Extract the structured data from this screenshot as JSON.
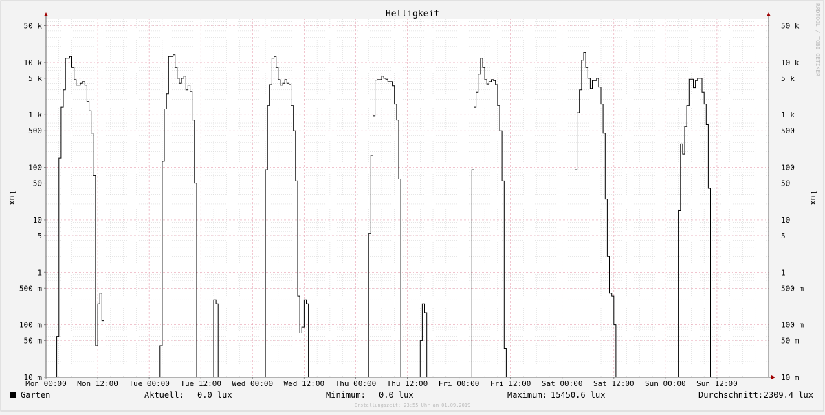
{
  "watermark": "RRDTOOL / TOBI OETIKER",
  "footer": "Erstellungszeit: 23:55 Uhr am 01.09.2019",
  "legend": {
    "series_name": "Garten",
    "current_label": "Aktuell:",
    "current_value": "0.0 lux",
    "min_label": "Minimum:",
    "min_value": "0.0 lux",
    "max_label": "Maximum:",
    "max_value": "15450.6 lux",
    "avg_label": "Durchschnitt:",
    "avg_value": "2309.4 lux"
  },
  "colors": {
    "background": "#f3f3f3",
    "plot": "#ffffff",
    "line": "#000000",
    "major_grid": "#e8a0b0",
    "minor_grid": "#cccccc"
  },
  "chart_data": {
    "type": "line",
    "title": "Helligkeit",
    "ylabel": "lux",
    "y_scale": "log",
    "ylim": [
      0.01,
      90000
    ],
    "xlim": [
      0,
      168
    ],
    "x_unit": "hours from Mon 00:00",
    "grid": true,
    "legend_position": "bottom",
    "y_ticks": [
      {
        "v": 0.01,
        "label": "10 m"
      },
      {
        "v": 0.05,
        "label": "50 m"
      },
      {
        "v": 0.1,
        "label": "100 m"
      },
      {
        "v": 0.5,
        "label": "500 m"
      },
      {
        "v": 1,
        "label": "1"
      },
      {
        "v": 5,
        "label": "5"
      },
      {
        "v": 10,
        "label": "10"
      },
      {
        "v": 50,
        "label": "50"
      },
      {
        "v": 100,
        "label": "100"
      },
      {
        "v": 500,
        "label": "500"
      },
      {
        "v": 1000,
        "label": "1 k"
      },
      {
        "v": 5000,
        "label": "5 k"
      },
      {
        "v": 10000,
        "label": "10 k"
      },
      {
        "v": 50000,
        "label": "50 k"
      }
    ],
    "x_ticks": [
      {
        "t": 0,
        "label": "Mon 00:00"
      },
      {
        "t": 12,
        "label": "Mon 12:00"
      },
      {
        "t": 24,
        "label": "Tue 00:00"
      },
      {
        "t": 36,
        "label": "Tue 12:00"
      },
      {
        "t": 48,
        "label": "Wed 00:00"
      },
      {
        "t": 60,
        "label": "Wed 12:00"
      },
      {
        "t": 72,
        "label": "Thu 00:00"
      },
      {
        "t": 84,
        "label": "Thu 12:00"
      },
      {
        "t": 96,
        "label": "Fri 00:00"
      },
      {
        "t": 108,
        "label": "Fri 12:00"
      },
      {
        "t": 120,
        "label": "Sat 00:00"
      },
      {
        "t": 132,
        "label": "Sat 12:00"
      },
      {
        "t": 144,
        "label": "Sun 00:00"
      },
      {
        "t": 156,
        "label": "Sun 12:00"
      }
    ],
    "series": [
      {
        "name": "Garten",
        "points": [
          [
            0,
            0
          ],
          [
            2.5,
            0
          ],
          [
            2.5,
            0.06
          ],
          [
            3,
            0.06
          ],
          [
            3,
            150
          ],
          [
            3.5,
            150
          ],
          [
            3.5,
            1400
          ],
          [
            4,
            1400
          ],
          [
            4,
            3000
          ],
          [
            4.5,
            3000
          ],
          [
            4.5,
            12000
          ],
          [
            5.5,
            12000
          ],
          [
            5.5,
            13000
          ],
          [
            6,
            13000
          ],
          [
            6,
            8000
          ],
          [
            6.5,
            8000
          ],
          [
            6.5,
            4700
          ],
          [
            7,
            4700
          ],
          [
            7,
            3700
          ],
          [
            8,
            3700
          ],
          [
            8,
            4000
          ],
          [
            8.5,
            4000
          ],
          [
            8.5,
            4300
          ],
          [
            9,
            4300
          ],
          [
            9,
            3700
          ],
          [
            9.5,
            3700
          ],
          [
            9.5,
            1800
          ],
          [
            10,
            1800
          ],
          [
            10,
            1200
          ],
          [
            10.5,
            1200
          ],
          [
            10.5,
            450
          ],
          [
            11,
            450
          ],
          [
            11,
            70
          ],
          [
            11.5,
            70
          ],
          [
            11.5,
            0.04
          ],
          [
            12,
            0.04
          ],
          [
            12,
            0.25
          ],
          [
            12.5,
            0.25
          ],
          [
            12.5,
            0.4
          ],
          [
            13,
            0.4
          ],
          [
            13,
            0.12
          ],
          [
            13.5,
            0.12
          ],
          [
            13.5,
            0
          ],
          [
            26.5,
            0
          ],
          [
            26.5,
            0.04
          ],
          [
            27,
            0.04
          ],
          [
            27,
            130
          ],
          [
            27.5,
            130
          ],
          [
            27.5,
            1300
          ],
          [
            28,
            1300
          ],
          [
            28,
            2500
          ],
          [
            28.5,
            2500
          ],
          [
            28.5,
            13000
          ],
          [
            29.5,
            13000
          ],
          [
            29.5,
            14000
          ],
          [
            30,
            14000
          ],
          [
            30,
            8000
          ],
          [
            30.5,
            8000
          ],
          [
            30.5,
            5000
          ],
          [
            31,
            5000
          ],
          [
            31,
            4000
          ],
          [
            31.5,
            4000
          ],
          [
            31.5,
            5000
          ],
          [
            32,
            5000
          ],
          [
            32,
            5500
          ],
          [
            32.5,
            5500
          ],
          [
            32.5,
            3000
          ],
          [
            33,
            3000
          ],
          [
            33,
            3700
          ],
          [
            33.5,
            3700
          ],
          [
            33.5,
            2800
          ],
          [
            34,
            2800
          ],
          [
            34,
            800
          ],
          [
            34.5,
            800
          ],
          [
            34.5,
            50
          ],
          [
            35,
            50
          ],
          [
            35,
            0
          ],
          [
            39,
            0
          ],
          [
            39,
            0.3
          ],
          [
            39.5,
            0.3
          ],
          [
            39.5,
            0.25
          ],
          [
            40,
            0.25
          ],
          [
            40,
            0
          ],
          [
            51,
            0
          ],
          [
            51,
            90
          ],
          [
            51.5,
            90
          ],
          [
            51.5,
            1500
          ],
          [
            52,
            1500
          ],
          [
            52,
            3800
          ],
          [
            52.5,
            3800
          ],
          [
            52.5,
            12000
          ],
          [
            53,
            12000
          ],
          [
            53,
            13000
          ],
          [
            53.5,
            13000
          ],
          [
            53.5,
            8000
          ],
          [
            54,
            8000
          ],
          [
            54,
            4700
          ],
          [
            54.5,
            4700
          ],
          [
            54.5,
            3700
          ],
          [
            55,
            3700
          ],
          [
            55,
            4000
          ],
          [
            55.5,
            4000
          ],
          [
            55.5,
            4700
          ],
          [
            56,
            4700
          ],
          [
            56,
            4000
          ],
          [
            56.5,
            4000
          ],
          [
            56.5,
            3800
          ],
          [
            57,
            3800
          ],
          [
            57,
            1500
          ],
          [
            57.5,
            1500
          ],
          [
            57.5,
            500
          ],
          [
            58,
            500
          ],
          [
            58,
            55
          ],
          [
            58.5,
            55
          ],
          [
            58.5,
            0.35
          ],
          [
            59,
            0.35
          ],
          [
            59,
            0.07
          ],
          [
            59.5,
            0.07
          ],
          [
            59.5,
            0.09
          ],
          [
            60,
            0.09
          ],
          [
            60,
            0.3
          ],
          [
            60.5,
            0.3
          ],
          [
            60.5,
            0.25
          ],
          [
            61,
            0.25
          ],
          [
            61,
            0
          ],
          [
            75,
            0
          ],
          [
            75,
            5.5
          ],
          [
            75.5,
            5.5
          ],
          [
            75.5,
            170
          ],
          [
            76,
            170
          ],
          [
            76,
            950
          ],
          [
            76.5,
            950
          ],
          [
            76.5,
            4600
          ],
          [
            77,
            4600
          ],
          [
            77,
            4700
          ],
          [
            78,
            4700
          ],
          [
            78,
            5500
          ],
          [
            78.5,
            5500
          ],
          [
            78.5,
            5000
          ],
          [
            79,
            5000
          ],
          [
            79,
            4800
          ],
          [
            79.5,
            4800
          ],
          [
            79.5,
            4300
          ],
          [
            80.5,
            4300
          ],
          [
            80.5,
            3600
          ],
          [
            81,
            3600
          ],
          [
            81,
            1600
          ],
          [
            81.5,
            1600
          ],
          [
            81.5,
            800
          ],
          [
            82,
            800
          ],
          [
            82,
            60
          ],
          [
            82.5,
            60
          ],
          [
            82.5,
            0
          ],
          [
            87,
            0
          ],
          [
            87,
            0.05
          ],
          [
            87.5,
            0.05
          ],
          [
            87.5,
            0.25
          ],
          [
            88,
            0.25
          ],
          [
            88,
            0.17
          ],
          [
            88.5,
            0.17
          ],
          [
            88.5,
            0
          ],
          [
            99,
            0
          ],
          [
            99,
            90
          ],
          [
            99.5,
            90
          ],
          [
            99.5,
            1400
          ],
          [
            100,
            1400
          ],
          [
            100,
            2700
          ],
          [
            100.5,
            2700
          ],
          [
            100.5,
            6000
          ],
          [
            101,
            6000
          ],
          [
            101,
            12000
          ],
          [
            101.5,
            12000
          ],
          [
            101.5,
            8000
          ],
          [
            102,
            8000
          ],
          [
            102,
            4700
          ],
          [
            102.5,
            4700
          ],
          [
            102.5,
            3900
          ],
          [
            103,
            3900
          ],
          [
            103,
            4300
          ],
          [
            103.5,
            4300
          ],
          [
            103.5,
            4700
          ],
          [
            104,
            4700
          ],
          [
            104,
            4500
          ],
          [
            104.5,
            4500
          ],
          [
            104.5,
            3800
          ],
          [
            105,
            3800
          ],
          [
            105,
            1500
          ],
          [
            105.5,
            1500
          ],
          [
            105.5,
            500
          ],
          [
            106,
            500
          ],
          [
            106,
            55
          ],
          [
            106.5,
            55
          ],
          [
            106.5,
            0.035
          ],
          [
            107,
            0.035
          ],
          [
            107,
            0
          ],
          [
            123,
            0
          ],
          [
            123,
            90
          ],
          [
            123.5,
            90
          ],
          [
            123.5,
            1100
          ],
          [
            124,
            1100
          ],
          [
            124,
            3000
          ],
          [
            124.5,
            3000
          ],
          [
            124.5,
            11000
          ],
          [
            125,
            11000
          ],
          [
            125,
            15450
          ],
          [
            125.5,
            15450
          ],
          [
            125.5,
            8000
          ],
          [
            126,
            8000
          ],
          [
            126,
            5000
          ],
          [
            126.5,
            5000
          ],
          [
            126.5,
            3200
          ],
          [
            127,
            3200
          ],
          [
            127,
            4500
          ],
          [
            128,
            4500
          ],
          [
            128,
            5000
          ],
          [
            128.5,
            5000
          ],
          [
            128.5,
            3400
          ],
          [
            129,
            3400
          ],
          [
            129,
            1600
          ],
          [
            129.5,
            1600
          ],
          [
            129.5,
            450
          ],
          [
            130,
            450
          ],
          [
            130,
            25
          ],
          [
            130.5,
            25
          ],
          [
            130.5,
            2
          ],
          [
            131,
            2
          ],
          [
            131,
            0.4
          ],
          [
            131.5,
            0.4
          ],
          [
            131.5,
            0.35
          ],
          [
            132,
            0.35
          ],
          [
            132,
            0.1
          ],
          [
            132.5,
            0.1
          ],
          [
            132.5,
            0
          ],
          [
            147,
            0
          ],
          [
            147,
            15
          ],
          [
            147.5,
            15
          ],
          [
            147.5,
            280
          ],
          [
            148,
            280
          ],
          [
            148,
            180
          ],
          [
            148.5,
            180
          ],
          [
            148.5,
            600
          ],
          [
            149,
            600
          ],
          [
            149,
            1500
          ],
          [
            149.5,
            1500
          ],
          [
            149.5,
            4800
          ],
          [
            150.5,
            4800
          ],
          [
            150.5,
            3300
          ],
          [
            151,
            3300
          ],
          [
            151,
            4500
          ],
          [
            151.5,
            4500
          ],
          [
            151.5,
            5000
          ],
          [
            152.5,
            5000
          ],
          [
            152.5,
            2700
          ],
          [
            153,
            2700
          ],
          [
            153,
            1600
          ],
          [
            153.5,
            1600
          ],
          [
            153.5,
            650
          ],
          [
            154,
            650
          ],
          [
            154,
            40
          ],
          [
            154.5,
            40
          ],
          [
            154.5,
            0
          ],
          [
            157,
            0
          ]
        ]
      }
    ]
  }
}
